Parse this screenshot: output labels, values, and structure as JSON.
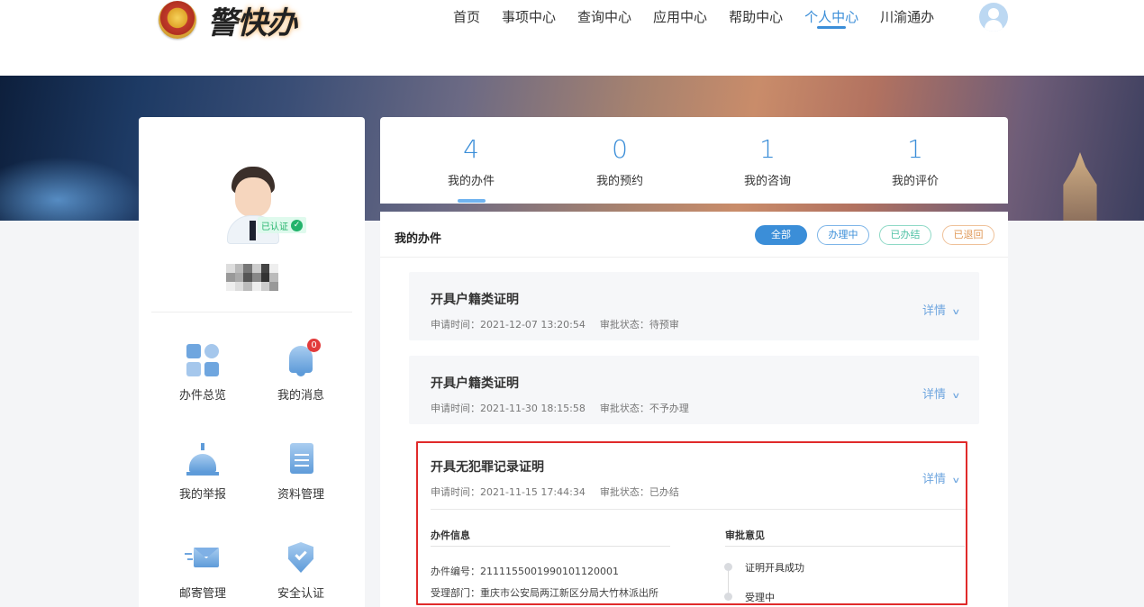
{
  "header": {
    "logo_text_1": "警",
    "logo_text_2": "快办",
    "nav": [
      "首页",
      "事项中心",
      "查询中心",
      "应用中心",
      "帮助中心",
      "个人中心",
      "川渝通办"
    ],
    "active_nav_index": 5
  },
  "profile": {
    "verified_label": "已认证",
    "menu": [
      {
        "label": "办件总览",
        "icon": "overview-icon"
      },
      {
        "label": "我的消息",
        "icon": "bell-icon",
        "badge": "0"
      },
      {
        "label": "我的举报",
        "icon": "alarm-icon"
      },
      {
        "label": "资料管理",
        "icon": "document-icon"
      },
      {
        "label": "邮寄管理",
        "icon": "mail-icon"
      },
      {
        "label": "安全认证",
        "icon": "shield-icon"
      }
    ]
  },
  "stats": [
    {
      "value": "4",
      "label": "我的办件"
    },
    {
      "value": "0",
      "label": "我的预约"
    },
    {
      "value": "1",
      "label": "我的咨询"
    },
    {
      "value": "1",
      "label": "我的评价"
    }
  ],
  "main": {
    "title": "我的办件",
    "filters": [
      "全部",
      "办理中",
      "已办结",
      "已退回"
    ],
    "items": [
      {
        "title": "开具户籍类证明",
        "time_label": "申请时间：2021-12-07 13:20:54",
        "status_label": "审批状态：待预审",
        "detail": "详情"
      },
      {
        "title": "开具户籍类证明",
        "time_label": "申请时间：2021-11-30 18:15:58",
        "status_label": "审批状态：不予办理",
        "detail": "详情"
      },
      {
        "title": "开具无犯罪记录证明",
        "time_label": "申请时间：2021-11-15 17:44:34",
        "status_label": "审批状态：已办结",
        "detail": "详情"
      }
    ],
    "expanded": {
      "info_head": "办件信息",
      "approval_head": "审批意见",
      "case_no": "办件编号：211115500199010112000​1",
      "department": "受理部门：重庆市公安局两江新区分局大竹林派出所",
      "timeline": [
        "证明开具成功",
        "受理中"
      ]
    }
  },
  "colors": {
    "accent": "#3b8ed8",
    "highlight": "#e02a2a"
  }
}
